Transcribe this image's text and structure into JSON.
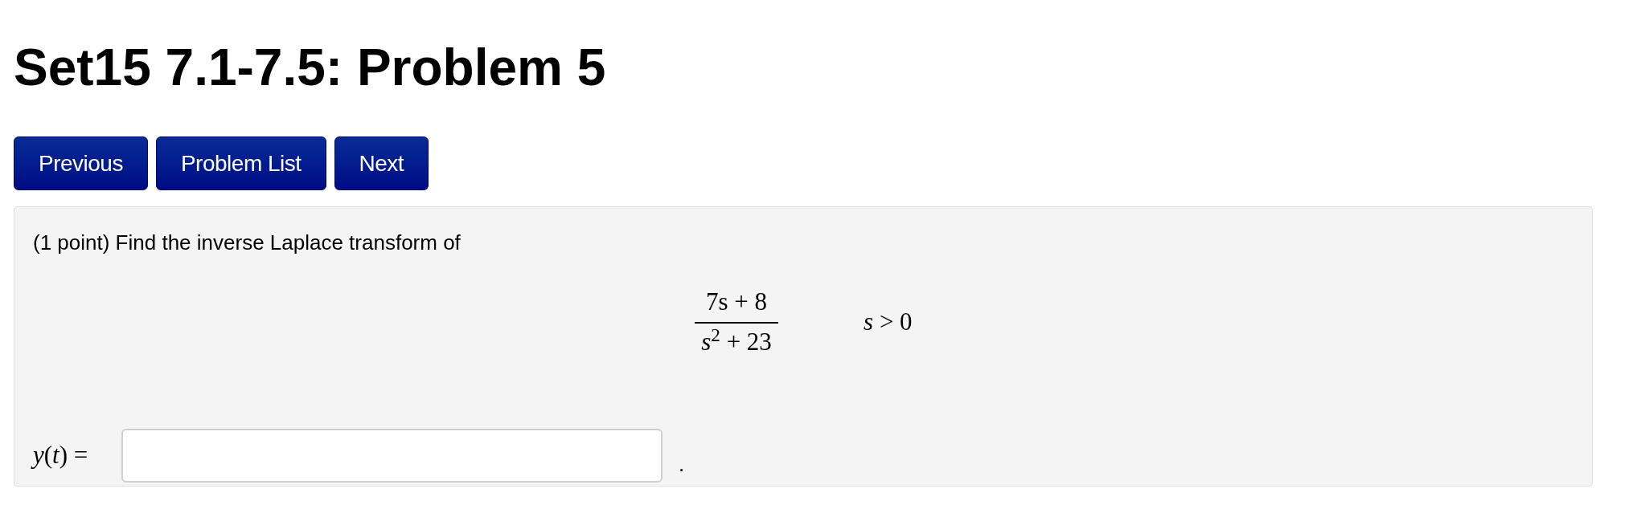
{
  "title": "Set15 7.1-7.5: Problem 5",
  "nav_buttons": [
    "Previous",
    "Problem List",
    "Next"
  ],
  "problem": {
    "statement": "(1 point) Find the inverse Laplace transform of",
    "fraction": {
      "numerator": "7s + 8",
      "denominator": "*s*$^{2}$ + 23"
    },
    "condition": "*s* > 0",
    "answer": {
      "label": "*y*(*t*) =",
      "trailing": "."
    }
  }
}
